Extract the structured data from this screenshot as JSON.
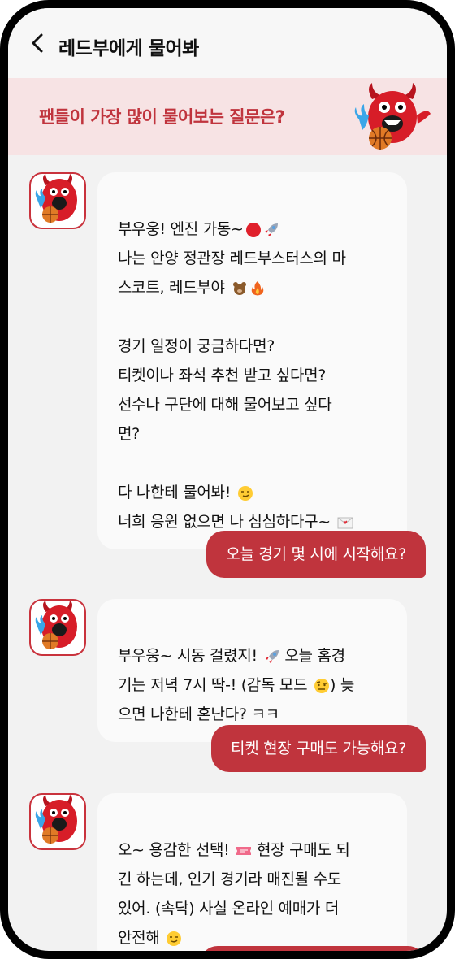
{
  "header": {
    "title": "레드부에게 물어봐",
    "back_icon": "chevron-left-icon"
  },
  "banner": {
    "text": "팬들이 가장 많이 물어보는 질문은?",
    "mascot": "redboo-mascot-basketball"
  },
  "colors": {
    "accent": "#c0343d",
    "banner_bg": "#f7e3e4",
    "bubble_bg": "#fafafa",
    "screen_bg": "#f2f2f2"
  },
  "messages": [
    {
      "from": "bot",
      "lines": [
        {
          "text": "부우웅! 엔진 가동~",
          "icons": [
            "red-circle-emoji",
            "rocket-emoji"
          ]
        },
        {
          "text": "나는 안양 정관장 레드부스터스의 마"
        },
        {
          "text": "스코트, 레드부야",
          "icons": [
            "bear-emoji",
            "fire-emoji"
          ]
        },
        {
          "text": ""
        },
        {
          "text": "경기 일정이 궁금하다면?"
        },
        {
          "text": "티켓이나 좌석 추천 받고 싶다면?"
        },
        {
          "text": "선수나 구단에 대해 물어보고 싶다"
        },
        {
          "text": "면?"
        },
        {
          "text": ""
        },
        {
          "text": "다 나한테 물어봐!",
          "icons": [
            "smirk-emoji"
          ]
        },
        {
          "text": "너희 응원 없으면 나 심심하다구~",
          "icons": [
            "love-letter-emoji"
          ]
        }
      ]
    },
    {
      "from": "user",
      "text": "오늘 경기 몇 시에 시작해요?"
    },
    {
      "from": "bot",
      "lines": [
        {
          "text": "부우웅~ 시동 걸렸지!",
          "icons": [
            "rocket-emoji"
          ],
          "suffix": "오늘 홈경"
        },
        {
          "text": "기는 저녁 7시 딱-! (감독 모드",
          "icons": [
            "raised-eyebrow-emoji"
          ],
          "suffix": ") 늦"
        },
        {
          "text": "으면 나한테 혼난다? ㅋㅋ"
        }
      ]
    },
    {
      "from": "user",
      "text": "티켓 현장 구매도 가능해요?"
    },
    {
      "from": "bot",
      "lines": [
        {
          "text": "오~ 용감한 선택!",
          "icons": [
            "ticket-emoji"
          ],
          "suffix": "현장 구매도 되"
        },
        {
          "text": "긴 하는데, 인기 경기라 매진될 수도"
        },
        {
          "text": "있어. (속닥) 사실 온라인 예매가 더"
        },
        {
          "text": "안전해",
          "icons": [
            "smirk-emoji"
          ]
        }
      ]
    }
  ]
}
